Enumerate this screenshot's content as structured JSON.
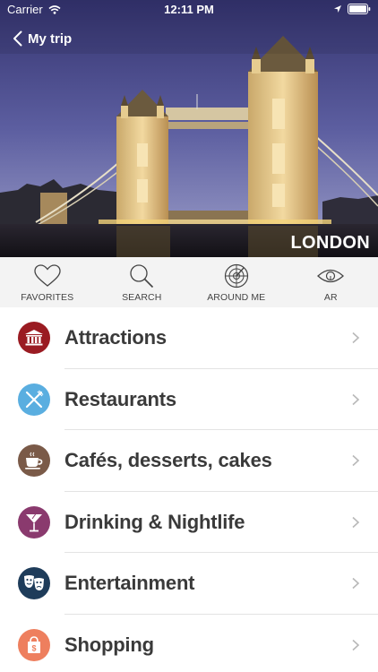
{
  "status_bar": {
    "carrier": "Carrier",
    "time": "12:11 PM"
  },
  "nav": {
    "back_label": "My trip"
  },
  "hero": {
    "city": "LONDON"
  },
  "toolbar": [
    {
      "label": "FAVORITES",
      "icon": "heart-icon"
    },
    {
      "label": "SEARCH",
      "icon": "search-icon"
    },
    {
      "label": "AROUND ME",
      "icon": "radar-icon"
    },
    {
      "label": "AR",
      "icon": "eye-icon"
    }
  ],
  "categories": [
    {
      "label": "Attractions",
      "icon": "museum-icon",
      "color": "#9a1b22"
    },
    {
      "label": "Restaurants",
      "icon": "fork-knife-icon",
      "color": "#5aaee0"
    },
    {
      "label": "Cafés, desserts, cakes",
      "icon": "coffee-cup-icon",
      "color": "#7a5a48"
    },
    {
      "label": "Drinking & Nightlife",
      "icon": "cocktail-icon",
      "color": "#8a3a6e"
    },
    {
      "label": "Entertainment",
      "icon": "theater-masks-icon",
      "color": "#1e3c5a"
    },
    {
      "label": "Shopping",
      "icon": "shopping-bag-icon",
      "color": "#ee7f5e"
    }
  ]
}
